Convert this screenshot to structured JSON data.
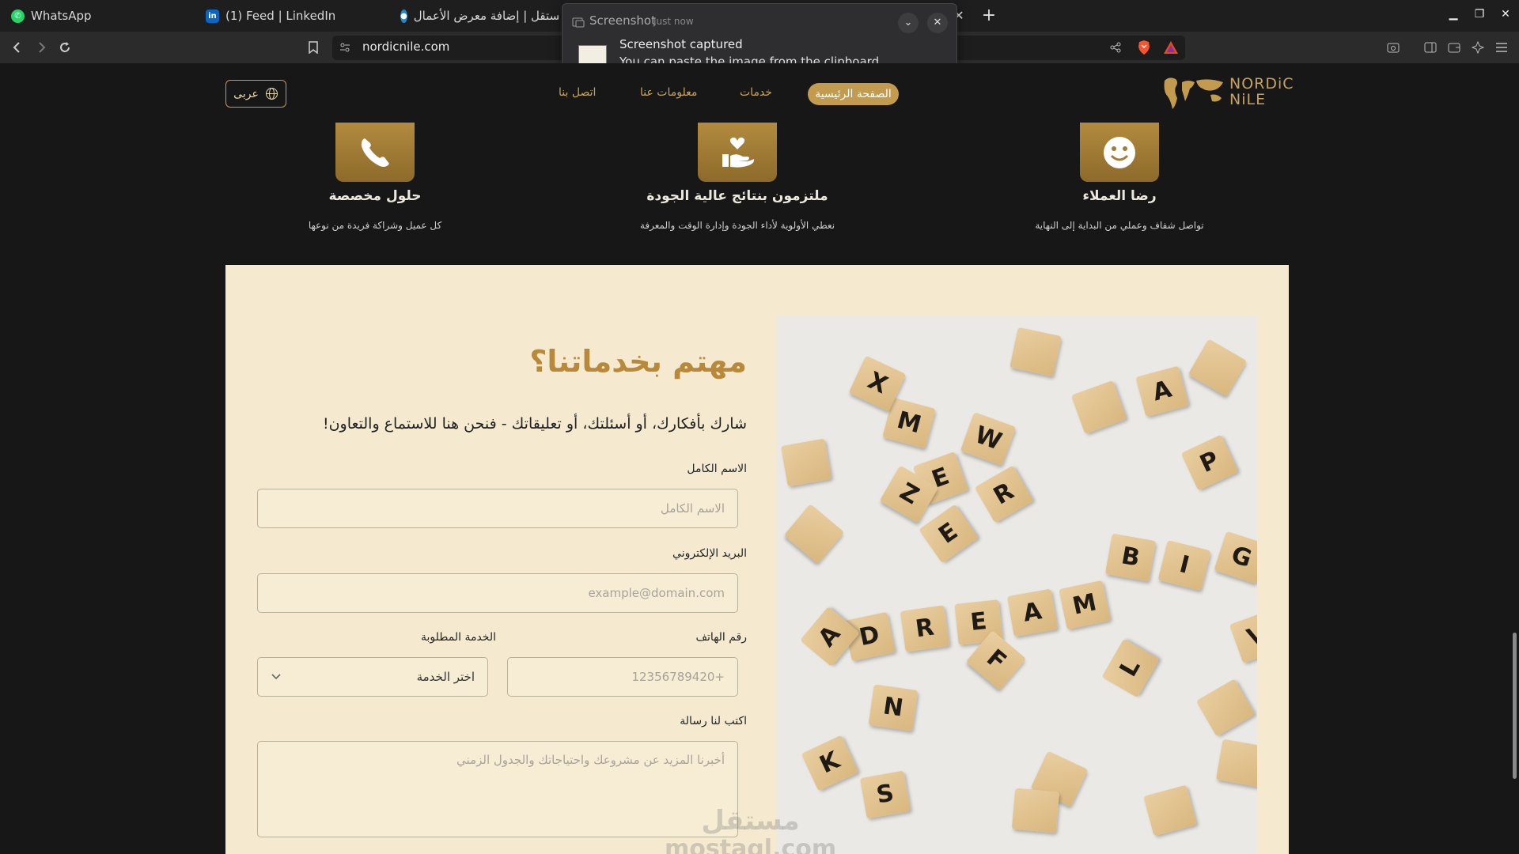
{
  "browser": {
    "tabs": [
      {
        "title": "WhatsApp",
        "icon": "whatsapp-icon"
      },
      {
        "title": "(1) Feed | LinkedIn",
        "icon": "linkedin-icon"
      },
      {
        "title": "مستقل | إضافة معرض الأعمال",
        "icon": "mostaql-icon"
      }
    ],
    "url": "nordicnile.com",
    "new_tab_label": "+"
  },
  "notification": {
    "app": "Screenshot",
    "time": "Just now",
    "title": "Screenshot captured",
    "body": "You can paste the image from the clipboard."
  },
  "site": {
    "nav": {
      "language_button": "عربى",
      "links": [
        "الصفحة الرئيسية",
        "خدمات",
        "معلومات عنا",
        "اتصل بنا"
      ],
      "logo_line1": "NORDiC",
      "logo_line2": "NiLE"
    },
    "features": [
      {
        "title": "رضا العملاء",
        "desc": "تواصل شفاف وعملي من البداية إلى النهاية",
        "icon": "smiley-icon"
      },
      {
        "title": "ملتزمون بنتائج عالية الجودة",
        "desc": "نعطي الأولوية لأداء الجودة وإدارة الوقت والمعرفة",
        "icon": "hand-heart-icon"
      },
      {
        "title": "حلول مخصصة",
        "desc": "كل عميل وشراكة فريدة من نوعها",
        "icon": "phone-icon"
      }
    ],
    "contact": {
      "heading": "مهتم بخدماتنا؟",
      "subheading": "شارك بأفكارك، أو أسئلتك، أو تعليقاتك - فنحن هنا للاستماع والتعاون!",
      "fields": {
        "name_label": "الاسم الكامل",
        "name_placeholder": "الاسم الكامل",
        "email_label": "البريد الإلكتروني",
        "email_placeholder": "example@domain.com",
        "phone_label": "رقم الهاتف",
        "phone_placeholder": "+12356789420",
        "service_label": "الخدمة المطلوبة",
        "service_value": "اختر الخدمة",
        "message_label": "اكتب لنا رسالة",
        "message_placeholder": "أخبرنا المزيد عن مشروعك واحتياجاتك والجدول الزمني"
      },
      "photo_tiles": [
        "D",
        "R",
        "E",
        "A",
        "M",
        "B",
        "I",
        "G",
        "N",
        "E",
        "R",
        "M",
        "S",
        "K",
        "F",
        "L",
        "V",
        "A",
        "E",
        "W",
        "Z",
        "X",
        "P",
        "A"
      ]
    },
    "watermark_line1": "مستقل",
    "watermark_line2": "mostaql.com"
  },
  "colors": {
    "accent": "#c39b4e",
    "heading_gold": "#b8893a",
    "contact_bg": "#f5ead0",
    "page_bg": "#171717"
  }
}
